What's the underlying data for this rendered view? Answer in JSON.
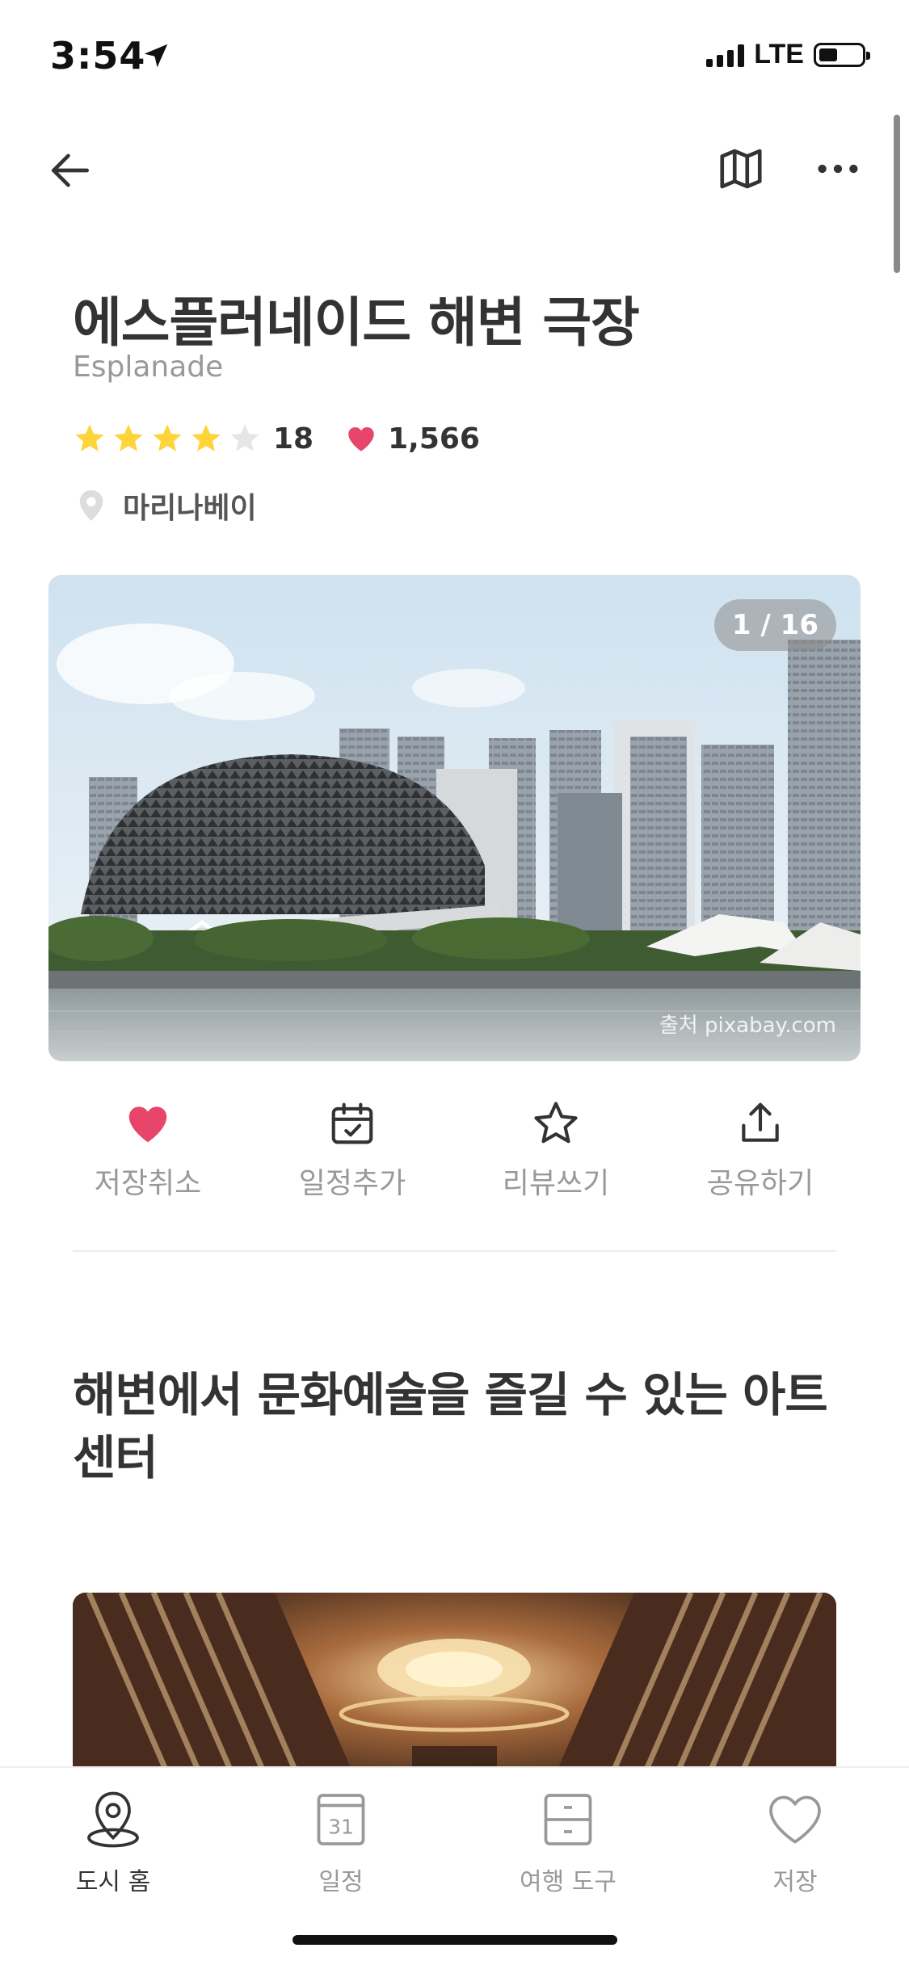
{
  "status_bar": {
    "time": "3:54",
    "network": "LTE"
  },
  "place": {
    "name": "에스플러네이드 해변 극장",
    "name_en": "Esplanade",
    "rating": 4,
    "rating_max": 5,
    "review_count": "18",
    "like_count": "1,566",
    "location": "마리나베이"
  },
  "gallery": {
    "counter": "1 / 16",
    "credit": "출처 pixabay.com"
  },
  "actions": {
    "unsave": "저장취소",
    "add_schedule": "일정추가",
    "write_review": "리뷰쓰기",
    "share": "공유하기"
  },
  "section": {
    "headline": "해변에서 문화예술을 즐길 수 있는 아트 센터"
  },
  "tabbar": {
    "city_home": "도시 홈",
    "schedule": "일정",
    "schedule_icon_day": "31",
    "travel_tools": "여행 도구",
    "saved": "저장"
  },
  "colors": {
    "heart": "#e8456a",
    "star": "#ffd43b",
    "star_empty": "#e6e6e6",
    "text_primary": "#333333",
    "text_secondary": "#999999"
  }
}
